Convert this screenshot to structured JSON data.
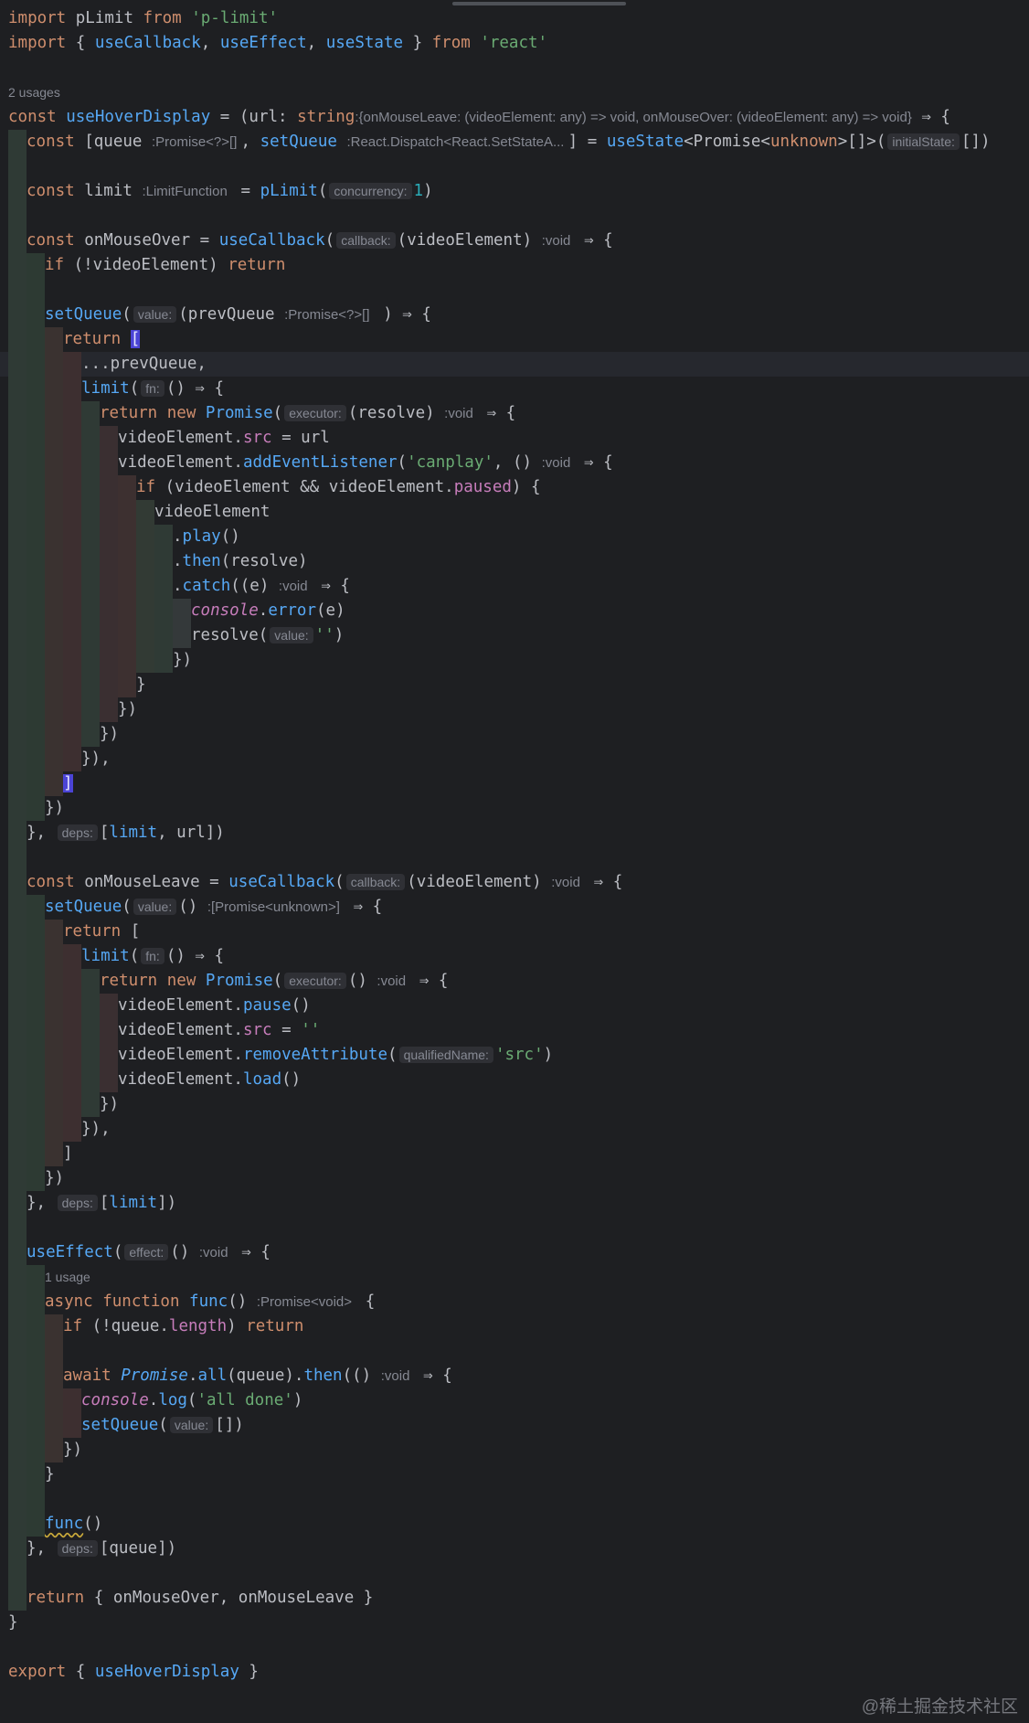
{
  "usage_labels": {
    "hook": "2 usages",
    "func": "1 usage"
  },
  "watermark": "@稀土掘金技术社区",
  "lines": [
    {
      "i": 0,
      "ind": 0,
      "t": [
        [
          "kw",
          "import "
        ],
        [
          "",
          "pLimit "
        ],
        [
          "kw",
          "from "
        ],
        [
          "str",
          "'p-limit'"
        ]
      ]
    },
    {
      "i": 1,
      "ind": 0,
      "t": [
        [
          "kw",
          "import "
        ],
        [
          "",
          "{ "
        ],
        [
          "fn",
          "useCallback"
        ],
        [
          "",
          ", "
        ],
        [
          "fn",
          "useEffect"
        ],
        [
          "",
          ", "
        ],
        [
          "fn",
          "useState"
        ],
        [
          "",
          " } "
        ],
        [
          "kw",
          "from "
        ],
        [
          "str",
          "'react'"
        ]
      ]
    },
    {
      "i": 2,
      "ind": 0,
      "t": []
    },
    {
      "i": 3,
      "ind": 0,
      "u": "hook",
      "t": []
    },
    {
      "i": 4,
      "ind": 0,
      "t": [
        [
          "kw",
          "const "
        ],
        [
          "fn",
          "useHoverDisplay"
        ],
        [
          "",
          " = (url: "
        ],
        [
          "kw",
          "string"
        ],
        [
          ") "
        ],
        [
          "ph",
          ":{onMouseLeave: (videoElement: any) => void, onMouseOver: (videoElement: any) => void}"
        ],
        [
          "",
          " ⇒ {"
        ]
      ]
    },
    {
      "i": 5,
      "ind": 1,
      "t": [
        [
          "kw",
          "const "
        ],
        [
          "",
          "[queue "
        ],
        [
          "ph",
          ":Promise<?>[] "
        ],
        [
          "",
          ", "
        ],
        [
          "fn",
          "setQueue "
        ],
        [
          "ph",
          ":React.Dispatch<React.SetStateA... "
        ],
        [
          "",
          "] = "
        ],
        [
          "fn",
          "useState"
        ],
        [
          "",
          "<Promise<"
        ],
        [
          "kw",
          "unknown"
        ],
        [
          "",
          ">[]>("
        ],
        [
          "chip",
          "initialState:"
        ],
        [
          "",
          "[])"
        ]
      ]
    },
    {
      "i": 6,
      "ind": 1,
      "t": []
    },
    {
      "i": 7,
      "ind": 1,
      "t": [
        [
          "kw",
          "const "
        ],
        [
          "",
          "limit "
        ],
        [
          "ph",
          ":LimitFunction "
        ],
        [
          "",
          " = "
        ],
        [
          "fn",
          "pLimit"
        ],
        [
          "",
          "("
        ],
        [
          "chip",
          "concurrency:"
        ],
        [
          "num",
          "1"
        ],
        [
          "",
          ")"
        ]
      ]
    },
    {
      "i": 8,
      "ind": 1,
      "t": []
    },
    {
      "i": 9,
      "ind": 1,
      "t": [
        [
          "kw",
          "const "
        ],
        [
          "",
          "onMouseOver = "
        ],
        [
          "fn",
          "useCallback"
        ],
        [
          "",
          "("
        ],
        [
          "chip",
          "callback:"
        ],
        [
          "",
          "(videoElement) "
        ],
        [
          "ph",
          ":void "
        ],
        [
          "",
          " ⇒ {"
        ]
      ]
    },
    {
      "i": 10,
      "ind": 2,
      "t": [
        [
          "kw",
          "if "
        ],
        [
          "",
          "(!videoElement) "
        ],
        [
          "kw",
          "return"
        ]
      ]
    },
    {
      "i": 11,
      "ind": 2,
      "t": []
    },
    {
      "i": 12,
      "ind": 2,
      "t": [
        [
          "fn",
          "setQueue"
        ],
        [
          "",
          "("
        ],
        [
          "chip",
          "value:"
        ],
        [
          "",
          "(prevQueue "
        ],
        [
          "ph",
          ":Promise<?>[] "
        ],
        [
          "",
          " ) ⇒ {"
        ]
      ]
    },
    {
      "i": 13,
      "ind": 3,
      "t": [
        [
          "kw",
          "return "
        ],
        [
          "br",
          "["
        ]
      ]
    },
    {
      "i": 14,
      "ind": 4,
      "cur": true,
      "t": [
        [
          "",
          "...prevQueue,"
        ]
      ]
    },
    {
      "i": 15,
      "ind": 4,
      "t": [
        [
          "fn",
          "limit"
        ],
        [
          "",
          "("
        ],
        [
          "chip",
          "fn:"
        ],
        [
          "",
          "() ⇒ {"
        ]
      ]
    },
    {
      "i": 16,
      "ind": 5,
      "t": [
        [
          "kw",
          "return new "
        ],
        [
          "fn",
          "Promise"
        ],
        [
          "",
          "("
        ],
        [
          "chip",
          "executor:"
        ],
        [
          "",
          "(resolve) "
        ],
        [
          "ph",
          ":void "
        ],
        [
          "",
          " ⇒ {"
        ]
      ]
    },
    {
      "i": 17,
      "ind": 6,
      "t": [
        [
          "",
          "videoElement."
        ],
        [
          "prop",
          "src"
        ],
        [
          "",
          " = url"
        ]
      ]
    },
    {
      "i": 18,
      "ind": 6,
      "t": [
        [
          "",
          "videoElement."
        ],
        [
          "fn",
          "addEventListener"
        ],
        [
          "",
          "("
        ],
        [
          "str",
          "'canplay'"
        ],
        [
          "",
          ", () "
        ],
        [
          "ph",
          ":void "
        ],
        [
          "",
          " ⇒ {"
        ]
      ]
    },
    {
      "i": 19,
      "ind": 7,
      "t": [
        [
          "kw",
          "if "
        ],
        [
          "",
          "(videoElement && videoElement."
        ],
        [
          "prop",
          "paused"
        ],
        [
          "",
          ") {"
        ]
      ]
    },
    {
      "i": 20,
      "ind": 8,
      "t": [
        [
          "",
          "videoElement"
        ]
      ]
    },
    {
      "i": 21,
      "ind": 9,
      "t": [
        [
          "",
          "."
        ],
        [
          "fn",
          "play"
        ],
        [
          "",
          "()"
        ]
      ]
    },
    {
      "i": 22,
      "ind": 9,
      "t": [
        [
          "",
          "."
        ],
        [
          "fn",
          "then"
        ],
        [
          "",
          "(resolve)"
        ]
      ]
    },
    {
      "i": 23,
      "ind": 9,
      "t": [
        [
          "",
          "."
        ],
        [
          "fn",
          "catch"
        ],
        [
          "",
          "((e) "
        ],
        [
          "ph",
          ":void "
        ],
        [
          "",
          " ⇒ {"
        ]
      ]
    },
    {
      "i": 24,
      "ind": 10,
      "t": [
        [
          "prop it",
          "console"
        ],
        [
          "",
          "."
        ],
        [
          "fn",
          "error"
        ],
        [
          "",
          "(e)"
        ]
      ]
    },
    {
      "i": 25,
      "ind": 10,
      "t": [
        [
          "",
          "resolve("
        ],
        [
          "chip",
          "value:"
        ],
        [
          "str",
          "''"
        ],
        [
          "",
          ")"
        ]
      ]
    },
    {
      "i": 26,
      "ind": 9,
      "t": [
        [
          "",
          "})"
        ]
      ]
    },
    {
      "i": 27,
      "ind": 7,
      "t": [
        [
          "",
          "}"
        ]
      ]
    },
    {
      "i": 28,
      "ind": 6,
      "t": [
        [
          "",
          "})"
        ]
      ]
    },
    {
      "i": 29,
      "ind": 5,
      "t": [
        [
          "",
          "})"
        ]
      ]
    },
    {
      "i": 30,
      "ind": 4,
      "t": [
        [
          "",
          "}),"
        ]
      ]
    },
    {
      "i": 31,
      "ind": 3,
      "t": [
        [
          "br",
          "]"
        ]
      ]
    },
    {
      "i": 32,
      "ind": 2,
      "t": [
        [
          "",
          "})"
        ]
      ]
    },
    {
      "i": 33,
      "ind": 1,
      "t": [
        [
          "",
          "}, "
        ],
        [
          "chip",
          "deps:"
        ],
        [
          "",
          "["
        ],
        [
          "fn",
          "limit"
        ],
        [
          "",
          ", url])"
        ]
      ]
    },
    {
      "i": 34,
      "ind": 1,
      "t": []
    },
    {
      "i": 35,
      "ind": 1,
      "t": [
        [
          "kw",
          "const "
        ],
        [
          "",
          "onMouseLeave = "
        ],
        [
          "fn",
          "useCallback"
        ],
        [
          "",
          "("
        ],
        [
          "chip",
          "callback:"
        ],
        [
          "",
          "(videoElement) "
        ],
        [
          "ph",
          ":void "
        ],
        [
          "",
          " ⇒ {"
        ]
      ]
    },
    {
      "i": 36,
      "ind": 2,
      "t": [
        [
          "fn",
          "setQueue"
        ],
        [
          "",
          "("
        ],
        [
          "chip",
          "value:"
        ],
        [
          "",
          "() "
        ],
        [
          "ph",
          ":[Promise<unknown>] "
        ],
        [
          "",
          " ⇒ {"
        ]
      ]
    },
    {
      "i": 37,
      "ind": 3,
      "t": [
        [
          "kw",
          "return "
        ],
        [
          "",
          "["
        ]
      ]
    },
    {
      "i": 38,
      "ind": 4,
      "t": [
        [
          "fn",
          "limit"
        ],
        [
          "",
          "("
        ],
        [
          "chip",
          "fn:"
        ],
        [
          "",
          "() ⇒ {"
        ]
      ]
    },
    {
      "i": 39,
      "ind": 5,
      "t": [
        [
          "kw",
          "return new "
        ],
        [
          "fn",
          "Promise"
        ],
        [
          "",
          "("
        ],
        [
          "chip",
          "executor:"
        ],
        [
          "",
          "() "
        ],
        [
          "ph",
          ":void "
        ],
        [
          "",
          " ⇒ {"
        ]
      ]
    },
    {
      "i": 40,
      "ind": 6,
      "t": [
        [
          "",
          "videoElement."
        ],
        [
          "fn",
          "pause"
        ],
        [
          "",
          "()"
        ]
      ]
    },
    {
      "i": 41,
      "ind": 6,
      "t": [
        [
          "",
          "videoElement."
        ],
        [
          "prop",
          "src"
        ],
        [
          "",
          " = "
        ],
        [
          "str",
          "''"
        ]
      ]
    },
    {
      "i": 42,
      "ind": 6,
      "t": [
        [
          "",
          "videoElement."
        ],
        [
          "fn",
          "removeAttribute"
        ],
        [
          "",
          "("
        ],
        [
          "chip",
          "qualifiedName:"
        ],
        [
          "str",
          "'src'"
        ],
        [
          "",
          ")"
        ]
      ]
    },
    {
      "i": 43,
      "ind": 6,
      "t": [
        [
          "",
          "videoElement."
        ],
        [
          "fn",
          "load"
        ],
        [
          "",
          "()"
        ]
      ]
    },
    {
      "i": 44,
      "ind": 5,
      "t": [
        [
          "",
          "})"
        ]
      ]
    },
    {
      "i": 45,
      "ind": 4,
      "t": [
        [
          "",
          "}),"
        ]
      ]
    },
    {
      "i": 46,
      "ind": 3,
      "t": [
        [
          "",
          "]"
        ]
      ]
    },
    {
      "i": 47,
      "ind": 2,
      "t": [
        [
          "",
          "})"
        ]
      ]
    },
    {
      "i": 48,
      "ind": 1,
      "t": [
        [
          "",
          "}, "
        ],
        [
          "chip",
          "deps:"
        ],
        [
          "",
          "["
        ],
        [
          "fn",
          "limit"
        ],
        [
          "",
          "])"
        ]
      ]
    },
    {
      "i": 49,
      "ind": 1,
      "t": []
    },
    {
      "i": 50,
      "ind": 1,
      "t": [
        [
          "fn",
          "useEffect"
        ],
        [
          "",
          "("
        ],
        [
          "chip",
          "effect:"
        ],
        [
          "",
          "() "
        ],
        [
          "ph",
          ":void "
        ],
        [
          "",
          " ⇒ {"
        ]
      ]
    },
    {
      "i": 51,
      "ind": 2,
      "u": "func",
      "t": []
    },
    {
      "i": 52,
      "ind": 2,
      "t": [
        [
          "kw",
          "async function "
        ],
        [
          "fn",
          "func"
        ],
        [
          "",
          "() "
        ],
        [
          "ph",
          ":Promise<void> "
        ],
        [
          "",
          " {"
        ]
      ]
    },
    {
      "i": 53,
      "ind": 3,
      "t": [
        [
          "kw",
          "if "
        ],
        [
          "",
          "(!queue."
        ],
        [
          "prop",
          "length"
        ],
        [
          "",
          ") "
        ],
        [
          "kw",
          "return"
        ]
      ]
    },
    {
      "i": 54,
      "ind": 3,
      "t": []
    },
    {
      "i": 55,
      "ind": 3,
      "t": [
        [
          "kw",
          "await "
        ],
        [
          "fn it",
          "Promise"
        ],
        [
          "",
          "."
        ],
        [
          "fn",
          "all"
        ],
        [
          "",
          "(queue)."
        ],
        [
          "fn",
          "then"
        ],
        [
          "",
          "(() "
        ],
        [
          "ph",
          ":void "
        ],
        [
          "",
          " ⇒ {"
        ]
      ]
    },
    {
      "i": 56,
      "ind": 4,
      "t": [
        [
          "prop it",
          "console"
        ],
        [
          "",
          "."
        ],
        [
          "fn",
          "log"
        ],
        [
          "",
          "("
        ],
        [
          "str",
          "'all done'"
        ],
        [
          "",
          ")"
        ]
      ]
    },
    {
      "i": 57,
      "ind": 4,
      "t": [
        [
          "fn",
          "setQueue"
        ],
        [
          "",
          "("
        ],
        [
          "chip",
          "value:"
        ],
        [
          "",
          "[])"
        ]
      ]
    },
    {
      "i": 58,
      "ind": 3,
      "t": [
        [
          "",
          "})"
        ]
      ]
    },
    {
      "i": 59,
      "ind": 2,
      "t": [
        [
          "",
          "}"
        ]
      ]
    },
    {
      "i": 60,
      "ind": 2,
      "t": []
    },
    {
      "i": 61,
      "ind": 2,
      "t": [
        [
          "fn squig",
          "func"
        ],
        [
          "",
          "()"
        ]
      ]
    },
    {
      "i": 62,
      "ind": 1,
      "t": [
        [
          "",
          "}, "
        ],
        [
          "chip",
          "deps:"
        ],
        [
          "",
          "[queue])"
        ]
      ]
    },
    {
      "i": 63,
      "ind": 1,
      "t": []
    },
    {
      "i": 64,
      "ind": 1,
      "t": [
        [
          "kw",
          "return "
        ],
        [
          "",
          "{ onMouseOver, onMouseLeave }"
        ]
      ]
    },
    {
      "i": 65,
      "ind": 0,
      "t": [
        [
          "",
          "}"
        ]
      ]
    },
    {
      "i": 66,
      "ind": 0,
      "t": []
    },
    {
      "i": 67,
      "ind": 0,
      "t": [
        [
          "kw",
          "export "
        ],
        [
          "",
          "{ "
        ],
        [
          "fn",
          "useHoverDisplay"
        ],
        [
          "",
          " }"
        ]
      ]
    }
  ]
}
